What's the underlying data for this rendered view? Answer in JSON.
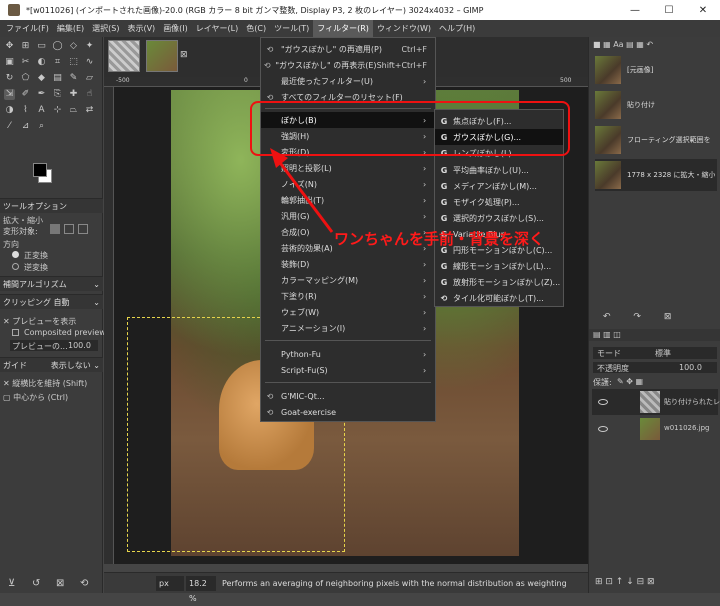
{
  "window": {
    "title": "*[w011026] (インポートされた画像)-20.0 (RGB カラー 8 bit ガンマ整数, Display P3, 2 枚のレイヤー) 3024x4032 – GIMP",
    "controls": [
      "—",
      "☐",
      "✕"
    ]
  },
  "menubar": [
    "ファイル(F)",
    "編集(E)",
    "選択(S)",
    "表示(V)",
    "画像(I)",
    "レイヤー(L)",
    "色(C)",
    "ツール(T)",
    "フィルター(R)",
    "ウィンドウ(W)",
    "ヘルプ(H)"
  ],
  "tool_options": {
    "tab": "ツールオプション",
    "tool_name": "拡大・縮小",
    "transform_label": "変形対象:",
    "direction_label": "方向",
    "direction_options": [
      "正変換",
      "逆変換"
    ],
    "interpolation_label": "補間アルゴリズム",
    "clipping_label": "クリッピング",
    "clipping_value": "自動",
    "show_preview": "プレビューを表示",
    "composited_preview": "Composited preview",
    "preview_opacity_label": "プレビューの...",
    "preview_opacity_value": "100.0",
    "guides_label": "ガイド",
    "guides_value": "表示しない",
    "keep_aspect": "縦横比を維持 (Shift)",
    "from_center": "中心から (Ctrl)"
  },
  "ruler": {
    "top_marks": [
      "-500",
      "0",
      "500"
    ]
  },
  "filters_menu": {
    "items": [
      {
        "icon": "⟲",
        "label": "\"ガウスぼかし\" の再適用(P)",
        "shortcut": "Ctrl+F",
        "arrow": ""
      },
      {
        "icon": "⟲",
        "label": "\"ガウスぼかし\" の再表示(E)",
        "shortcut": "Shift+Ctrl+F",
        "arrow": ""
      },
      {
        "icon": "",
        "label": "最近使ったフィルター(U)",
        "shortcut": "",
        "arrow": "›"
      },
      {
        "icon": "⟲",
        "label": "すべてのフィルターのリセット(F)",
        "shortcut": "",
        "arrow": ""
      },
      {
        "icon": "",
        "label": "ぼかし(B)",
        "shortcut": "",
        "arrow": "›",
        "highlight": true
      },
      {
        "icon": "",
        "label": "強調(H)",
        "shortcut": "",
        "arrow": "›"
      },
      {
        "icon": "",
        "label": "変形(D)",
        "shortcut": "",
        "arrow": "›"
      },
      {
        "icon": "",
        "label": "照明と投影(L)",
        "shortcut": "",
        "arrow": "›"
      },
      {
        "icon": "",
        "label": "ノイズ(N)",
        "shortcut": "",
        "arrow": "›"
      },
      {
        "icon": "",
        "label": "輪郭抽出(T)",
        "shortcut": "",
        "arrow": "›"
      },
      {
        "icon": "",
        "label": "汎用(G)",
        "shortcut": "",
        "arrow": "›"
      },
      {
        "icon": "",
        "label": "合成(O)",
        "shortcut": "",
        "arrow": "›"
      },
      {
        "icon": "",
        "label": "芸術的効果(A)",
        "shortcut": "",
        "arrow": "›"
      },
      {
        "icon": "",
        "label": "装飾(D)",
        "shortcut": "",
        "arrow": "›"
      },
      {
        "icon": "",
        "label": "カラーマッピング(M)",
        "shortcut": "",
        "arrow": "›"
      },
      {
        "icon": "",
        "label": "下塗り(R)",
        "shortcut": "",
        "arrow": "›"
      },
      {
        "icon": "",
        "label": "ウェブ(W)",
        "shortcut": "",
        "arrow": "›"
      },
      {
        "icon": "",
        "label": "アニメーション(I)",
        "shortcut": "",
        "arrow": "›"
      },
      {
        "icon": "",
        "label": "Python-Fu",
        "shortcut": "",
        "arrow": "›"
      },
      {
        "icon": "",
        "label": "Script-Fu(S)",
        "shortcut": "",
        "arrow": "›"
      },
      {
        "icon": "⟲",
        "label": "G'MIC-Qt...",
        "shortcut": "",
        "arrow": ""
      },
      {
        "icon": "⟲",
        "label": "Goat-exercise",
        "shortcut": "",
        "arrow": ""
      }
    ]
  },
  "blur_submenu": {
    "items": [
      {
        "label": "焦点ぼかし(F)..."
      },
      {
        "label": "ガウスぼかし(G)...",
        "highlight": true
      },
      {
        "label": "レンズぼかし(L)..."
      },
      {
        "label": "平均曲率ぼかし(U)..."
      },
      {
        "label": "メディアンぼかし(M)..."
      },
      {
        "label": "モザイク処理(P)..."
      },
      {
        "label": "選択的ガウスぼかし(S)..."
      },
      {
        "label": "Variable Blur"
      },
      {
        "label": "円形モーションぼかし(C)..."
      },
      {
        "label": "線形モーションぼかし(L)..."
      },
      {
        "label": "放射形モーションぼかし(Z)..."
      },
      {
        "label": "タイル化可能ぼかし(T)..."
      }
    ]
  },
  "annotation": "ワンちゃんを手前・背景を深く",
  "history": {
    "items": [
      "[元画像]",
      "貼り付け",
      "フローティング選択範囲を",
      "1778 x 2328 に拡大・縮小"
    ]
  },
  "layers": {
    "mode_label": "モード",
    "mode_value": "標準",
    "opacity_label": "不透明度",
    "opacity_value": "100.0",
    "lock_label": "保護:",
    "items": [
      "貼り付けられたレ",
      "w011026.jpg"
    ]
  },
  "statusbar": {
    "unit": "px",
    "zoom": "18.2 %",
    "message": "Performs an averaging of neighboring pixels with the normal distribution as weighting"
  }
}
